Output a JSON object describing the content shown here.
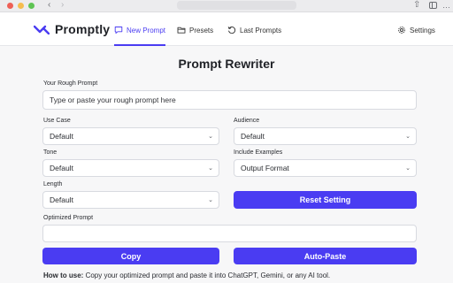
{
  "app": {
    "brand": "Promptly"
  },
  "nav": {
    "new_prompt": "New Prompt",
    "presets": "Presets",
    "last_prompts": "Last Prompts",
    "settings": "Settings"
  },
  "main": {
    "title": "Prompt Rewriter",
    "rough_prompt": {
      "label": "Your Rough Prompt",
      "placeholder": "Type or paste your rough prompt here"
    },
    "use_case": {
      "label": "Use Case",
      "value": "Default"
    },
    "audience": {
      "label": "Audience",
      "value": "Default"
    },
    "tone": {
      "label": "Tone",
      "value": "Default"
    },
    "include_examples": {
      "label": "Include Examples",
      "value": "Output Format"
    },
    "length": {
      "label": "Length",
      "value": "Default"
    },
    "reset_button": "Reset Setting",
    "optimized": {
      "label": "Optimized Prompt",
      "value": ""
    },
    "copy_button": "Copy",
    "autopaste_button": "Auto-Paste",
    "howto": {
      "lead": "How to use:",
      "text": " Copy your optimized prompt and paste it into ChatGPT, Gemini, or any AI tool."
    }
  },
  "colors": {
    "accent": "#4a3cf2"
  }
}
